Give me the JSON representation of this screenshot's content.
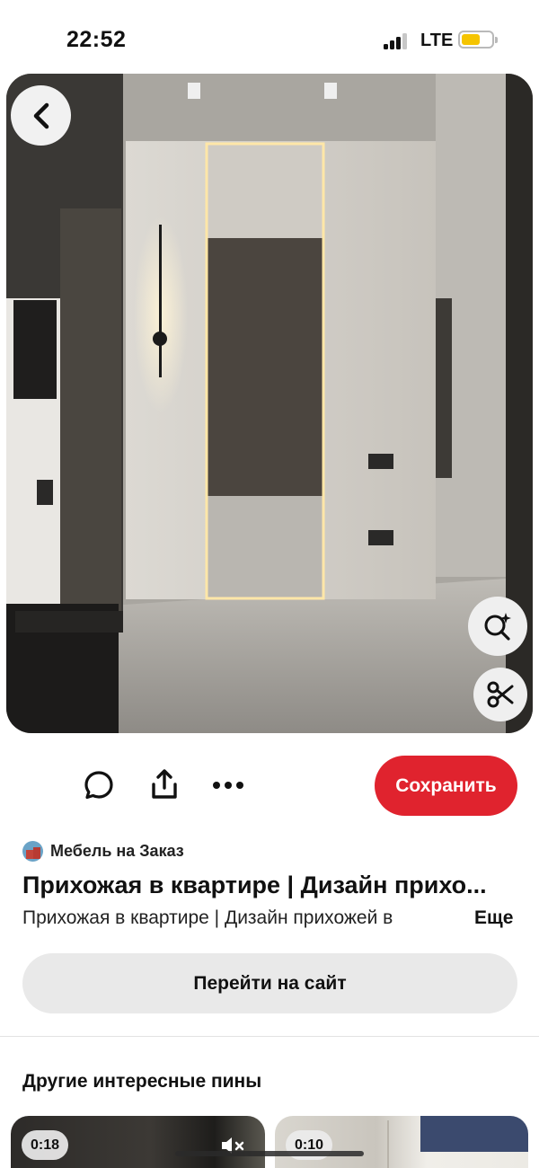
{
  "status_bar": {
    "time": "22:52",
    "network": "LTE",
    "battery_level": 0.55,
    "battery_color": "#f5c400"
  },
  "hero": {
    "back_icon": "chevron-left-icon",
    "visual_search_icon": "visual-search-icon",
    "crop_icon": "scissors-icon"
  },
  "actions": {
    "comment_icon": "comment-icon",
    "share_icon": "share-icon",
    "more_icon": "more-dots-icon",
    "save_label": "Сохранить",
    "save_color": "#e0232e"
  },
  "pin": {
    "author": "Мебель на Заказ",
    "title": "Прихожая в квартире | Дизайн прихо...",
    "description": "Прихожая в квартире | Дизайн прихожей в",
    "more_label": "Еще",
    "visit_label": "Перейти на сайт"
  },
  "related": {
    "title": "Другие интересные пины",
    "pins": [
      {
        "duration": "0:18",
        "muted": true
      },
      {
        "duration": "0:10",
        "muted": false
      }
    ]
  }
}
